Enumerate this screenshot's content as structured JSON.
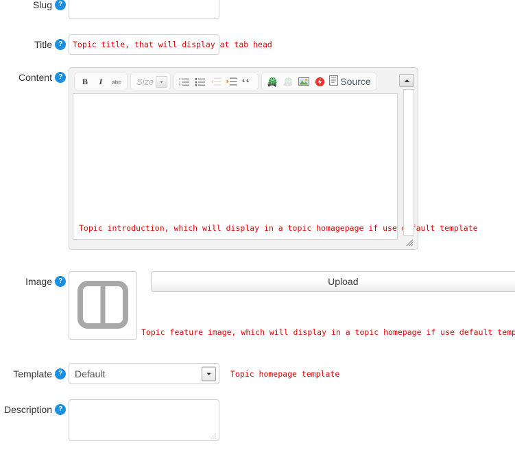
{
  "form": {
    "fields": {
      "slug": {
        "label": "Slug",
        "help_icon": "help-icon",
        "value": "",
        "placeholder": ""
      },
      "title": {
        "label": "Title",
        "help_icon": "help-icon",
        "value": "",
        "placeholder": "",
        "hint": "Topic title, that will display at tab head"
      },
      "content": {
        "label": "Content",
        "help_icon": "help-icon",
        "hint": "Topic introduction, which will display in a topic homagepage if use default template"
      },
      "image": {
        "label": "Image",
        "help_icon": "help-icon",
        "upload_label": "Upload",
        "placeholder_icon": "image-placeholder-icon",
        "hint": "Topic feature image, which will display in a topic homepage if use default template"
      },
      "template": {
        "label": "Template",
        "help_icon": "help-icon",
        "selected": "Default",
        "options": [
          "Default"
        ],
        "hint": "Topic homepage template"
      },
      "description": {
        "label": "Description",
        "help_icon": "help-icon",
        "value": "",
        "placeholder": ""
      }
    }
  },
  "editor": {
    "toolbar": {
      "groups": [
        {
          "name": "basic-styles",
          "buttons": [
            {
              "name": "bold-icon",
              "label": "B"
            },
            {
              "name": "italic-icon",
              "label": "I"
            },
            {
              "name": "strikethrough-icon",
              "label": "abc"
            }
          ]
        },
        {
          "name": "font-size",
          "buttons": [
            {
              "name": "font-size-dropdown",
              "label": "Size"
            }
          ]
        },
        {
          "name": "paragraph",
          "buttons": [
            {
              "name": "numbered-list-icon",
              "label": "Insert/Remove Numbered List"
            },
            {
              "name": "bulleted-list-icon",
              "label": "Insert/Remove Bulleted List"
            },
            {
              "name": "outdent-icon",
              "label": "Decrease Indent"
            },
            {
              "name": "indent-icon",
              "label": "Increase Indent"
            },
            {
              "name": "blockquote-icon",
              "label": "Block Quote"
            }
          ]
        },
        {
          "name": "insert",
          "buttons": [
            {
              "name": "link-icon",
              "label": "Link"
            },
            {
              "name": "unlink-icon",
              "label": "Unlink"
            },
            {
              "name": "image-icon",
              "label": "Image"
            },
            {
              "name": "flash-icon",
              "label": "Flash"
            },
            {
              "name": "source-icon",
              "label": "Source"
            }
          ]
        }
      ],
      "collapse_label": "Collapse Toolbar",
      "source_label": "Source",
      "size_label": "Size"
    },
    "content": "",
    "resize_label": "Resize"
  },
  "colors": {
    "hint_red": "#e00000",
    "help_blue": "#1b8fe0",
    "border_grey": "#cfcfcf",
    "editor_bg": "#f2f2f2"
  }
}
